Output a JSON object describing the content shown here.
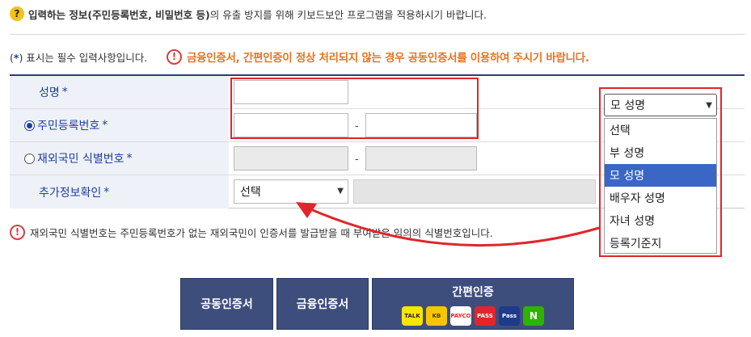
{
  "notice_top": {
    "bold": "입력하는 정보(주민등록번호, 비밀번호 등)",
    "rest": "의 유출 방지를 위해 키보드보안 프로그램을 적용하시기 바랍니다."
  },
  "required_note": {
    "open": "(",
    "star": "*",
    "close": ")",
    "text": "표시는 필수 입력사항입니다."
  },
  "cert_warning": "금융인증서, 간편인증이 정상 처리되지 않는 경우 공동인증서를 이용하여 주시기 바랍니다.",
  "form": {
    "name_label": "성명",
    "rrn_label": "주민등록번호",
    "foreigner_label": "재외국민 식별번호",
    "extra_label": "추가정보확인",
    "required_star": "*",
    "dash": "-",
    "extra_select_value": "선택"
  },
  "relation_select": {
    "value": "모 성명",
    "options": [
      "선택",
      "부 성명",
      "모 성명",
      "배우자 성명",
      "자녀 성명",
      "등록기준지"
    ],
    "selected_index": 2
  },
  "notice_bottom": "재외국민 식별번호는 주민등록번호가 없는 재외국민이 인증서를 발급받을 때 부여받은 임의의 식별번호입니다.",
  "buttons": {
    "joint_cert": "공동인증서",
    "financial_cert": "금융인증서",
    "easy_auth": "간편인증"
  },
  "easy_auth_logos": [
    {
      "label": "TALK",
      "bg": "#f7e600",
      "fg": "#3a1d1d"
    },
    {
      "label": "KB",
      "bg": "#f7c600",
      "fg": "#4a3a00"
    },
    {
      "label": "PAYCO",
      "bg": "#ffffff",
      "fg": "#e22828"
    },
    {
      "label": "PASS",
      "bg": "#e0262b",
      "fg": "#ffffff"
    },
    {
      "label": "Pass",
      "bg": "#1e3a8a",
      "fg": "#ffffff"
    },
    {
      "label": "N",
      "bg": "#2db400",
      "fg": "#ffffff"
    }
  ],
  "colors": {
    "accent_navy": "#2c3d74",
    "warning_orange": "#e8731e",
    "highlight_red": "#e0262b",
    "selected_blue": "#3a66c5"
  }
}
